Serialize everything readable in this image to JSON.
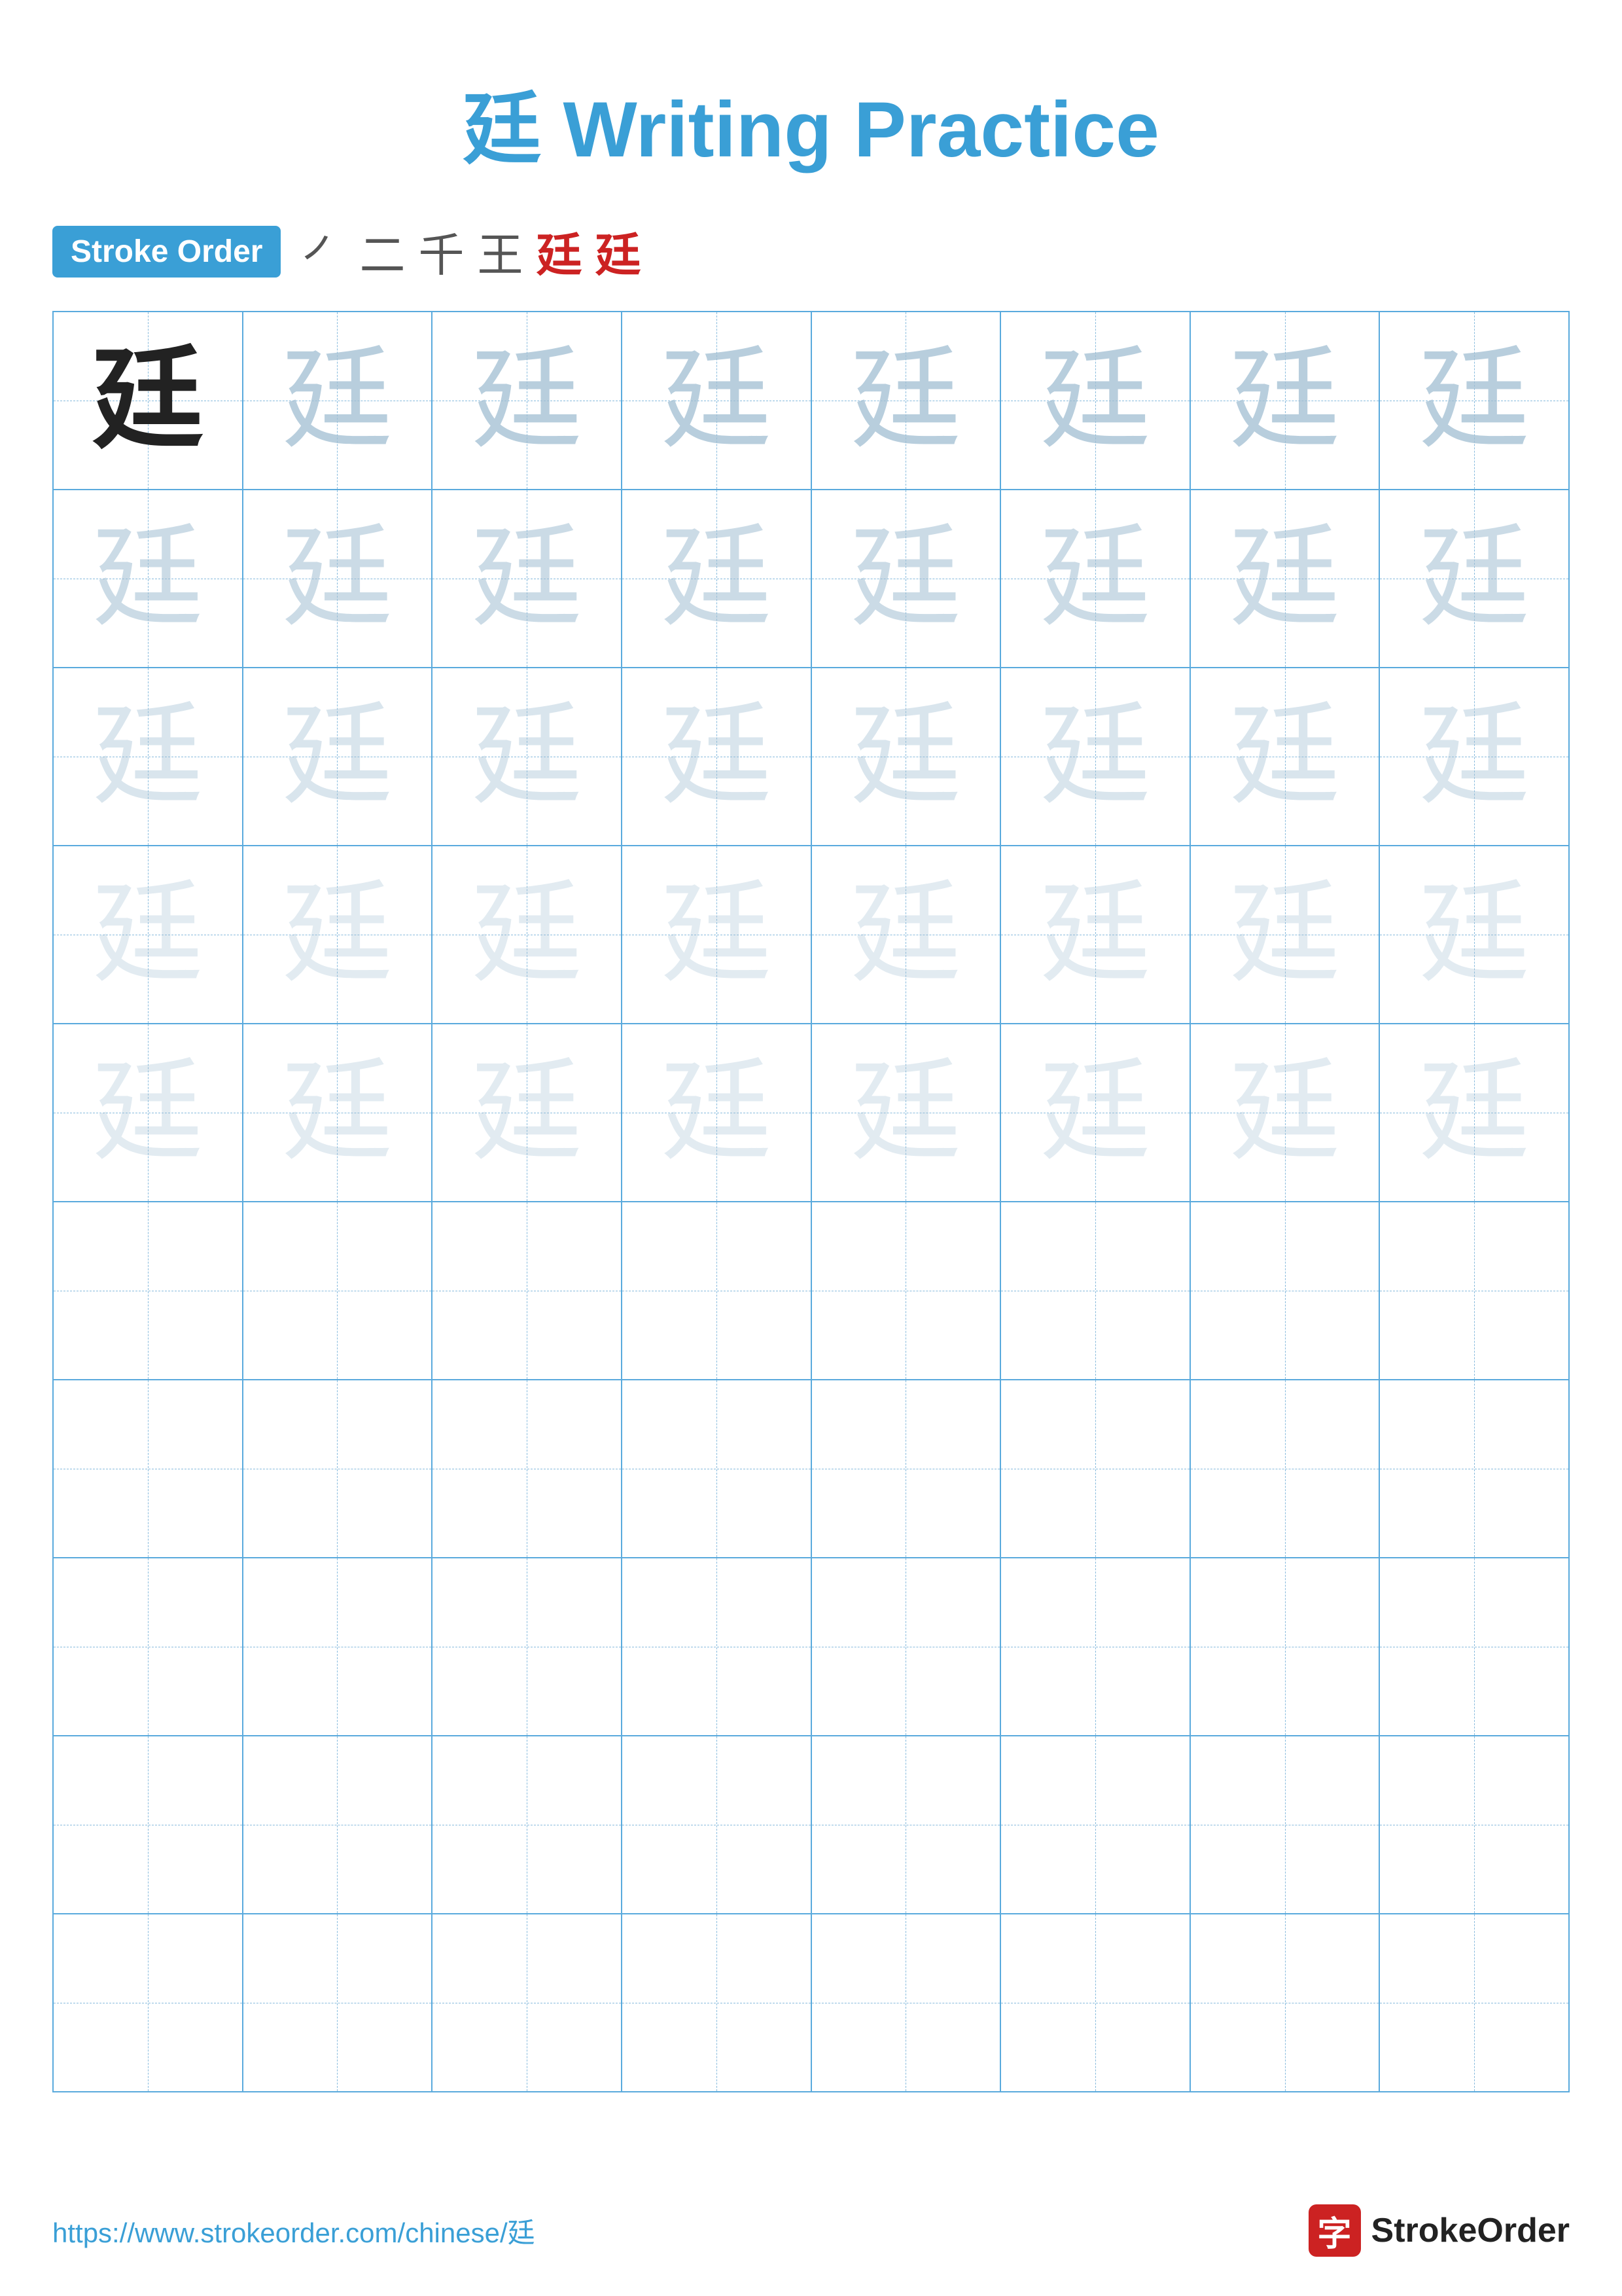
{
  "title": "廷 Writing Practice",
  "stroke_order": {
    "badge_label": "Stroke Order",
    "strokes": [
      "㇒",
      "二",
      "千",
      "王",
      "廷",
      "廷"
    ]
  },
  "character": "廷",
  "grid": {
    "rows": 10,
    "cols": 8,
    "practice_rows_with_chars": 5,
    "empty_rows": 5
  },
  "footer": {
    "url": "https://www.strokeorder.com/chinese/廷",
    "brand_icon": "字",
    "brand_name": "StrokeOrder"
  }
}
